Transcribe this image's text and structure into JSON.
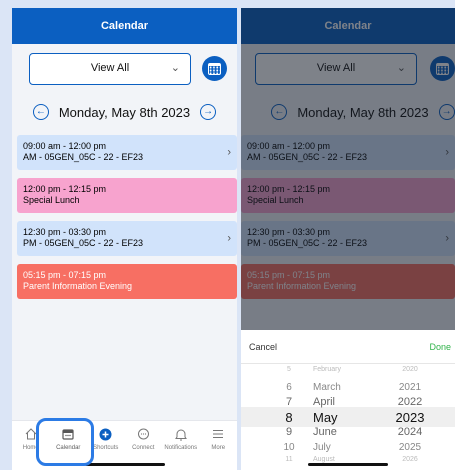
{
  "app": {
    "title": "Calendar"
  },
  "filter": {
    "value": "View All"
  },
  "date": {
    "label": "Monday, May 8th 2023"
  },
  "events": [
    {
      "time": "09:00 am - 12:00 pm",
      "title": "AM - 05GEN_05C - 22 - EF23",
      "color": "#d1e3fb",
      "has_arrow": true
    },
    {
      "time": "12:00 pm - 12:15 pm",
      "title": "Special Lunch",
      "color": "#f7a3ce",
      "has_arrow": false
    },
    {
      "time": "12:30 pm - 03:30 pm",
      "title": "PM - 05GEN_05C - 22 - EF23",
      "color": "#d1e3fb",
      "has_arrow": true
    },
    {
      "time": "05:15 pm - 07:15 pm",
      "title": "Parent Information Evening",
      "color": "#f76f63",
      "has_arrow": false
    }
  ],
  "tabs": [
    {
      "label": "Home",
      "icon": "home-icon"
    },
    {
      "label": "Calendar",
      "icon": "calendar-icon"
    },
    {
      "label": "Shortcuts",
      "icon": "plus-circle-icon"
    },
    {
      "label": "Connect",
      "icon": "chat-icon"
    },
    {
      "label": "Notifications",
      "icon": "bell-icon"
    },
    {
      "label": "More",
      "icon": "menu-icon"
    }
  ],
  "picker": {
    "cancel_label": "Cancel",
    "done_label": "Done",
    "rows": [
      {
        "day": "5",
        "month": "February",
        "year": "2020"
      },
      {
        "day": "6",
        "month": "March",
        "year": "2021"
      },
      {
        "day": "7",
        "month": "April",
        "year": "2022"
      },
      {
        "day": "8",
        "month": "May",
        "year": "2023"
      },
      {
        "day": "9",
        "month": "June",
        "year": "2024"
      },
      {
        "day": "10",
        "month": "July",
        "year": "2025"
      },
      {
        "day": "11",
        "month": "August",
        "year": "2026"
      }
    ],
    "selected_index": 3
  },
  "colors": {
    "brand": "#0b5fc1",
    "done": "#30b34a",
    "highlight": "#2c7be5"
  }
}
